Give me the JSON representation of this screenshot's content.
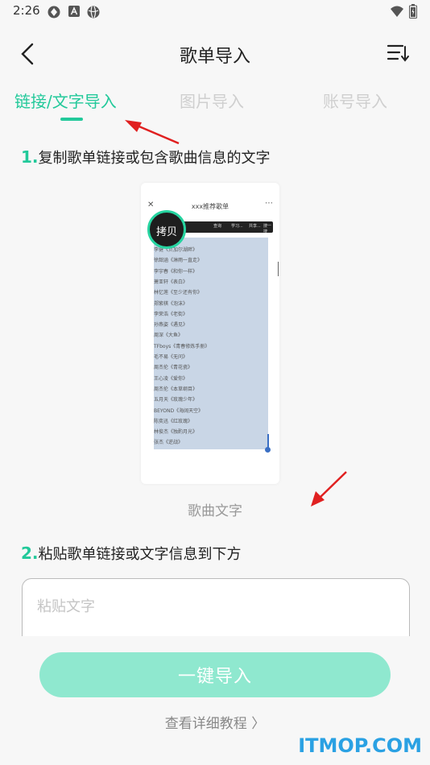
{
  "status_bar": {
    "time": "2:26"
  },
  "header": {
    "title": "歌单导入"
  },
  "tabs": [
    {
      "label": "链接/文字导入",
      "active": true
    },
    {
      "label": "图片导入",
      "active": false
    },
    {
      "label": "账号导入",
      "active": false
    }
  ],
  "step1": {
    "num": "1.",
    "text": "复制歌单链接或包含歌曲信息的文字"
  },
  "preview": {
    "title": "xxx推荐歌单",
    "copy_label": "拷贝",
    "menu": [
      "查询",
      "学习...",
      "共享...",
      "搜一搜"
    ],
    "songs": [
      "李健《贝加尔湖畔》",
      "徐韶涵《淋雨一直走》",
      "李宇春《和你一样》",
      "萧亚轩《表白》",
      "林忆莲《至少还有你》",
      "郑紫棋《泡沫》",
      "李荣浩《老街》",
      "孙燕姿《遇见》",
      "周深《大鱼》",
      "TFboys《青春修炼手册》",
      "毛不易《无问》",
      "周杰伦《青花瓷》",
      "王心凌《爱你》",
      "周杰伦《本草纲目》",
      "五月天《玫瑰少年》",
      "BEYOND《海阔天空》",
      "陈奕迅《红玫瑰》",
      "林俊杰《独酌月光》",
      "张杰《逆战》"
    ]
  },
  "caption": "歌曲文字",
  "step2": {
    "num": "2.",
    "text": "粘贴歌单链接或文字信息到下方"
  },
  "input": {
    "placeholder": "粘贴文字",
    "value": ""
  },
  "import_button": "一键导入",
  "tutorial_link": "查看详细教程 〉",
  "watermark": "ITMOP.COM",
  "colors": {
    "accent": "#22c99a",
    "button": "#8fe8cf",
    "arrow": "#e02020",
    "watermark": "#2aa1e3"
  }
}
